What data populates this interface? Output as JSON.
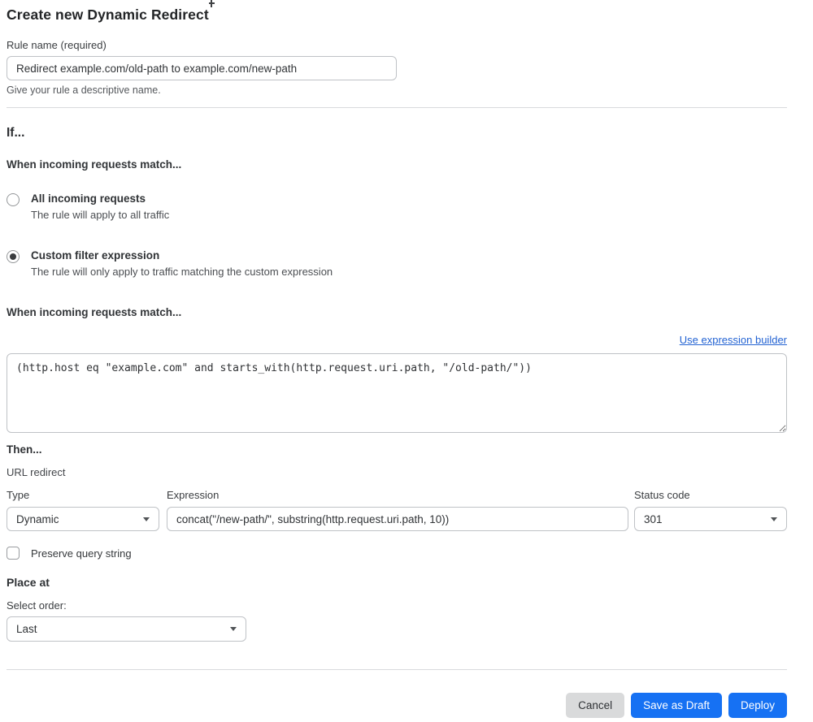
{
  "page": {
    "title": "Create new Dynamic Redirect"
  },
  "rule_name": {
    "label": "Rule name (required)",
    "value": "Redirect example.com/old-path to example.com/new-path",
    "help": "Give your rule a descriptive name."
  },
  "if_section": {
    "heading": "If...",
    "subheading": "When incoming requests match...",
    "options": [
      {
        "label": "All incoming requests",
        "description": "The rule will apply to all traffic",
        "selected": false
      },
      {
        "label": "Custom filter expression",
        "description": "The rule will only apply to traffic matching the custom expression",
        "selected": true
      }
    ]
  },
  "expression_section": {
    "heading": "When incoming requests match...",
    "builder_link": "Use expression builder",
    "expression": "(http.host eq \"example.com\" and starts_with(http.request.uri.path, \"/old-path/\"))"
  },
  "then_section": {
    "heading": "Then...",
    "subheading": "URL redirect",
    "type": {
      "label": "Type",
      "value": "Dynamic"
    },
    "expression": {
      "label": "Expression",
      "value": "concat(\"/new-path/\", substring(http.request.uri.path, 10))"
    },
    "status_code": {
      "label": "Status code",
      "value": "301"
    },
    "preserve_query": {
      "label": "Preserve query string",
      "checked": false
    }
  },
  "place_at": {
    "heading": "Place at",
    "label": "Select order:",
    "value": "Last"
  },
  "footer": {
    "cancel_label": "Cancel",
    "save_draft_label": "Save as Draft",
    "deploy_label": "Deploy"
  },
  "colors": {
    "accent_blue": "#1671f3",
    "link_blue": "#2363d3",
    "text_dark": "#2e3134",
    "cancel_bg": "#d9dadb"
  }
}
